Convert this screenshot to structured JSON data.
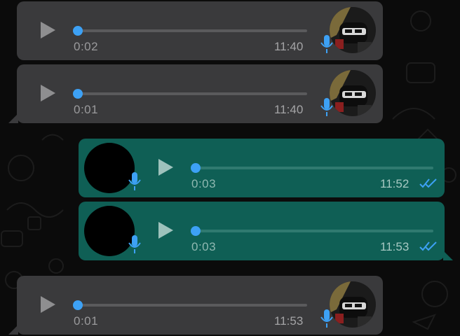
{
  "colors": {
    "incoming_bubble": "#3a3a3c",
    "outgoing_bubble": "#0f5f55",
    "accent_blue": "#3da1f5",
    "wallpaper": "#0b0b0b"
  },
  "messages": [
    {
      "direction": "incoming",
      "duration": "0:02",
      "time": "11:40",
      "progress": 0
    },
    {
      "direction": "incoming",
      "duration": "0:01",
      "time": "11:40",
      "progress": 0
    },
    {
      "direction": "outgoing",
      "duration": "0:03",
      "time": "11:52",
      "progress": 0,
      "status": "read"
    },
    {
      "direction": "outgoing",
      "duration": "0:03",
      "time": "11:53",
      "progress": 0,
      "status": "read"
    },
    {
      "direction": "incoming",
      "duration": "0:01",
      "time": "11:53",
      "progress": 0
    }
  ],
  "icons": {
    "play": "play-icon",
    "mic": "microphone-icon",
    "read_receipt": "double-check-icon"
  }
}
